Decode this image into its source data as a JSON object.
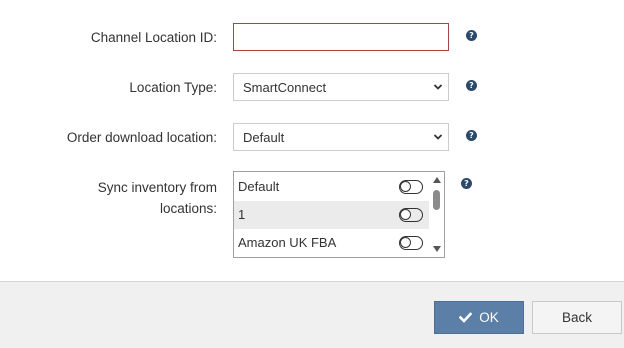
{
  "form": {
    "channel_location_id": {
      "label": "Channel Location ID:",
      "value": "",
      "placeholder": ""
    },
    "location_type": {
      "label": "Location Type:",
      "selected": "SmartConnect"
    },
    "order_download_location": {
      "label": "Order download location:",
      "selected": "Default"
    },
    "sync_inventory": {
      "label_line1": "Sync inventory from",
      "label_line2": "locations:",
      "items": [
        {
          "label": "Default",
          "enabled": false
        },
        {
          "label": "1",
          "enabled": false
        },
        {
          "label": "Amazon UK FBA",
          "enabled": false
        }
      ]
    },
    "help_glyph": "?"
  },
  "footer": {
    "ok_label": "OK",
    "back_label": "Back"
  },
  "colors": {
    "ok_button": "#5b7fa6",
    "error_border": "#a94442",
    "help_icon": "#2b4a6a",
    "footer_bg": "#f0f0f0"
  },
  "icons": {
    "help": "question-circle-icon",
    "ok": "checkmark-icon",
    "dropdown": "chevron-down-icon"
  }
}
